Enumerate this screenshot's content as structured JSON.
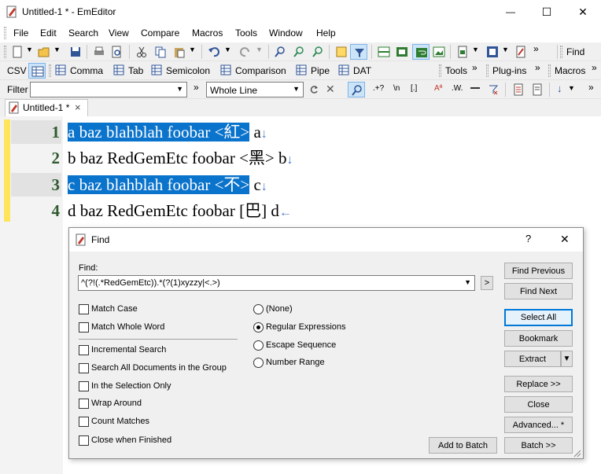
{
  "window": {
    "title": "Untitled-1 * - EmEditor",
    "minimize_glyph": "—",
    "maximize_glyph": "☐",
    "close_glyph": "✕"
  },
  "menu": [
    "File",
    "Edit",
    "Search",
    "View",
    "Compare",
    "Macros",
    "Tools",
    "Window",
    "Help"
  ],
  "toolbar": {
    "find_label": "Find",
    "chevron": "»"
  },
  "csv_bar": {
    "csv_label": "CSV",
    "items": [
      "Comma",
      "Tab",
      "Semicolon",
      "Comparison",
      "Pipe",
      "DAT"
    ],
    "tools_label": "Tools",
    "plugins_label": "Plug-ins",
    "macros_label": "Macros",
    "chevron": "»"
  },
  "filter_bar": {
    "filter_label": "Filter",
    "mode_value": "Whole Line",
    "chevron": "»",
    "regex_sym": ".+?",
    "newline_sym": "\\n",
    "bracket_sym": "[.]",
    "case_sym": "Aª",
    "word_sym": ".W."
  },
  "tab": {
    "label": "Untitled-1 *",
    "close_glyph": "×"
  },
  "editor": {
    "lines": [
      {
        "num": "1",
        "selected": "a baz blahblah foobar <紅>",
        "rest": " a",
        "eol": "↓"
      },
      {
        "num": "2",
        "selected": "",
        "rest": "b baz RedGemEtc foobar <黑> b",
        "eol": "↓"
      },
      {
        "num": "3",
        "selected": "c baz blahblah foobar <不>",
        "rest": " c",
        "eol": "↓"
      },
      {
        "num": "4",
        "selected": "",
        "rest": "d baz RedGemEtc foobar [巴] d",
        "eol": "←"
      }
    ]
  },
  "find": {
    "title": "Find",
    "help_glyph": "?",
    "close_glyph": "✕",
    "find_label": "Find:",
    "find_value": "^(?!(.*RedGemEtc)).*(?(1)xyzzy|<.>)",
    "arrow_glyph": ">",
    "checkboxes": [
      "Match Case",
      "Match Whole Word",
      "Incremental Search",
      "Search All Documents in the Group",
      "In the Selection Only",
      "Wrap Around",
      "Count Matches",
      "Close when Finished"
    ],
    "radios": [
      "(None)",
      "Regular Expressions",
      "Escape Sequence",
      "Number Range"
    ],
    "radio_selected": "Regular Expressions",
    "buttons": {
      "find_previous": "Find Previous",
      "find_next": "Find Next",
      "select_all": "Select All",
      "bookmark": "Bookmark",
      "extract": "Extract",
      "replace": "Replace >>",
      "close": "Close",
      "advanced": "Advanced... *",
      "add_to_batch": "Add to Batch",
      "batch": "Batch >>"
    }
  },
  "colors": {
    "selection": "#0a73cc",
    "line_number": "#2e5a2e",
    "eol_marker": "#4b7cc7",
    "change_bar": "#ffe45c",
    "accent": "#0078d7"
  }
}
